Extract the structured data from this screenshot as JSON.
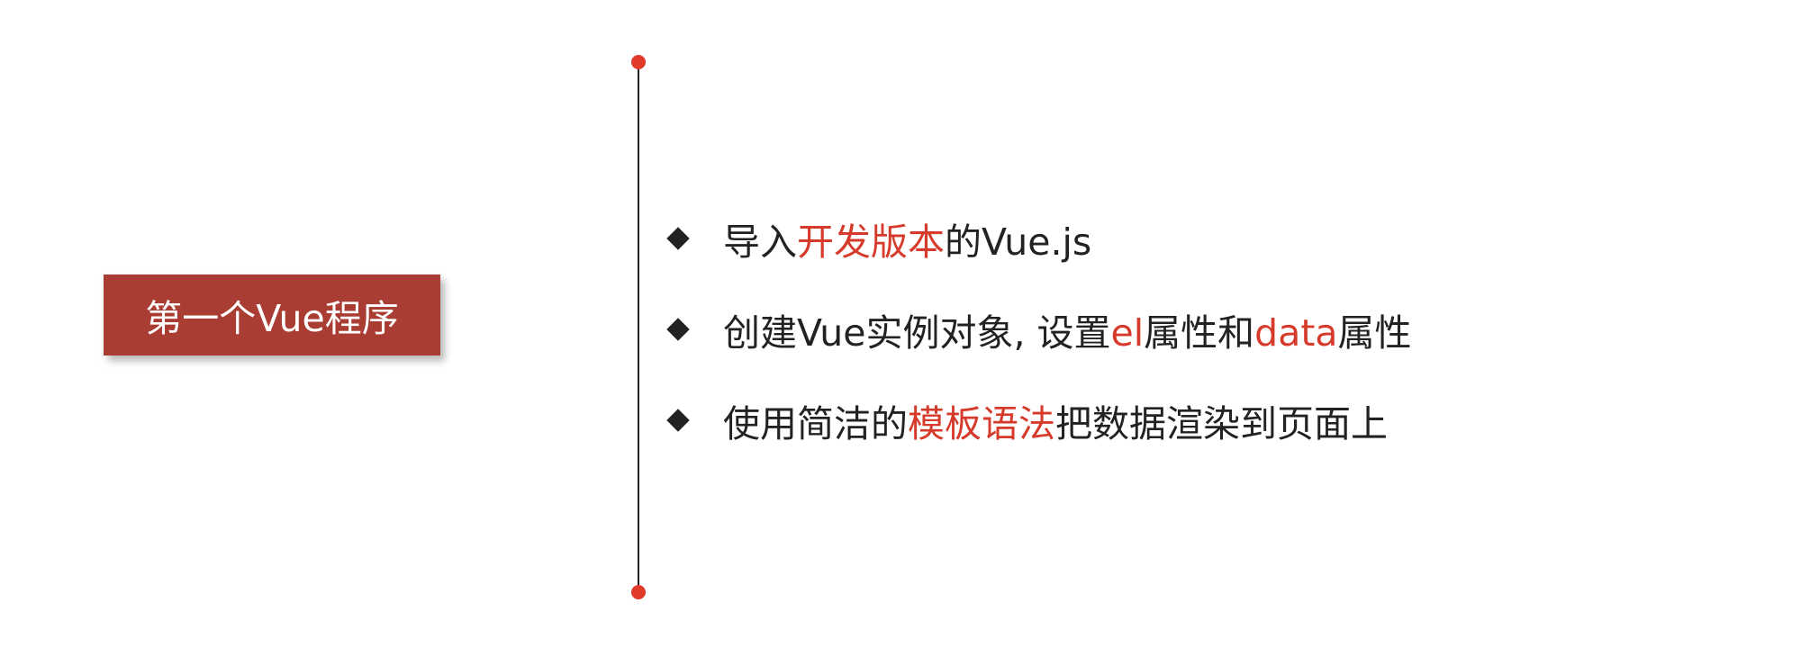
{
  "slide": {
    "title": "第一个Vue程序",
    "bullets": [
      {
        "segments": [
          {
            "text": "导入",
            "highlight": false
          },
          {
            "text": "开发版本",
            "highlight": true
          },
          {
            "text": "的Vue.js",
            "highlight": false
          }
        ]
      },
      {
        "segments": [
          {
            "text": "创建Vue实例对象, 设置",
            "highlight": false
          },
          {
            "text": "el",
            "highlight": true
          },
          {
            "text": "属性和",
            "highlight": false
          },
          {
            "text": "data",
            "highlight": true
          },
          {
            "text": "属性",
            "highlight": false
          }
        ]
      },
      {
        "segments": [
          {
            "text": "使用简洁的",
            "highlight": false
          },
          {
            "text": "模板语法",
            "highlight": true
          },
          {
            "text": "把数据渲染到页面上",
            "highlight": false
          }
        ]
      }
    ]
  },
  "colors": {
    "title_background": "#a93d33",
    "highlight": "#d63a2b",
    "timeline_dot": "#e03a2b",
    "text": "#222222"
  }
}
